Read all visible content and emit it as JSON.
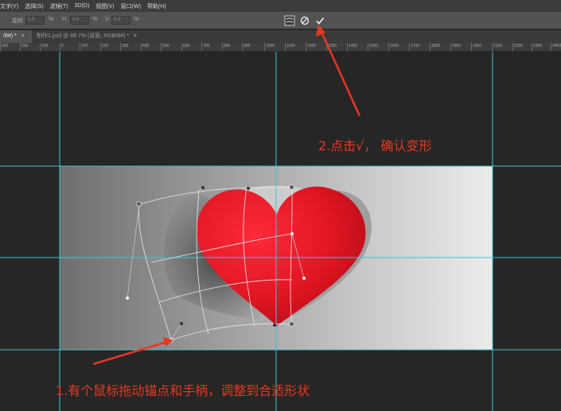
{
  "menubar": {
    "items": [
      "文字(Y)",
      "选择(S)",
      "滤镜(T)",
      "3D(D)",
      "视图(V)",
      "窗口(W)",
      "帮助(H)"
    ]
  },
  "options": {
    "angle_label": "旋转",
    "angle_value": "0.0",
    "deg1": "%",
    "h_label": "H:",
    "h_value": "0.0",
    "pct": "%",
    "v_label": "V:",
    "v_value": "0.0",
    "pct2": "%"
  },
  "tabs": [
    {
      "label": "/8#) *",
      "active": true
    },
    {
      "label": "制作1.psd @ 88.7% (背面, RGB/8#) *",
      "active": false
    }
  ],
  "ruler": {
    "ticks": [
      "300",
      "200",
      "100",
      "0",
      "100",
      "200",
      "300",
      "400",
      "500",
      "600",
      "700",
      "800",
      "900",
      "1000",
      "1100",
      "1200",
      "1300",
      "1400",
      "1500",
      "1600",
      "1700",
      "1800",
      "1900",
      "2000",
      "2100",
      "2200",
      "2300",
      "2400"
    ]
  },
  "annotations": {
    "step2": "2.点击√，  确认变形",
    "step1": "1.有个鼠标拖动锚点和手柄，调整到合适形状"
  },
  "colors": {
    "annotation": "#e8371f",
    "guide": "#3fc3d6",
    "heart": "#e01622"
  },
  "icons": {
    "warp_mode": "warp-mode-icon",
    "cancel": "cancel-icon",
    "commit": "checkmark-icon"
  }
}
